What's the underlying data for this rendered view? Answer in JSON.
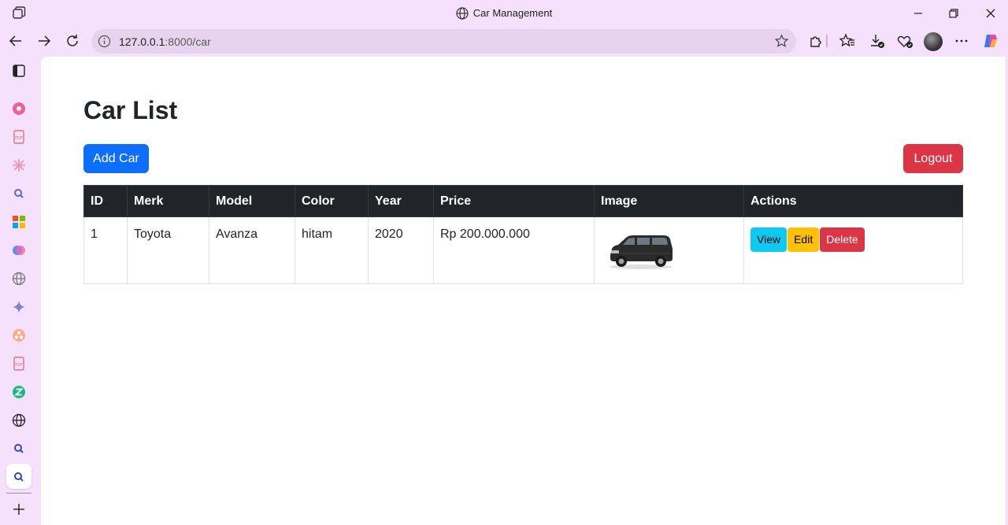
{
  "window": {
    "title": "Car Management"
  },
  "browser": {
    "url_host": "127.0.0.1",
    "url_path": ":8000/car"
  },
  "page": {
    "title": "Car List",
    "add_button": "Add Car",
    "logout_button": "Logout"
  },
  "table": {
    "headers": {
      "id": "ID",
      "merk": "Merk",
      "model": "Model",
      "color": "Color",
      "year": "Year",
      "price": "Price",
      "image": "Image",
      "actions": "Actions"
    },
    "rows": [
      {
        "id": "1",
        "merk": "Toyota",
        "model": "Avanza",
        "color": "hitam",
        "year": "2020",
        "price": "Rp 200.000.000",
        "actions": {
          "view": "View",
          "edit": "Edit",
          "delete": "Delete"
        }
      }
    ]
  },
  "colors": {
    "primary": "#0d6efd",
    "danger": "#dc3545",
    "info": "#0dcaf0",
    "warning": "#ffc107",
    "table_header": "#212529",
    "frame": "#f5e1fb"
  },
  "sidebar_icons": [
    "sidebar-toggle-icon",
    "music-icon",
    "pdf-icon",
    "sparkle-icon",
    "search-icon",
    "office-icon",
    "copilot-icon",
    "globe-icon",
    "ai-star-icon",
    "share-icon",
    "pdf-icon",
    "z-app-icon",
    "globe-icon",
    "search-icon",
    "search-icon",
    "add-icon"
  ]
}
